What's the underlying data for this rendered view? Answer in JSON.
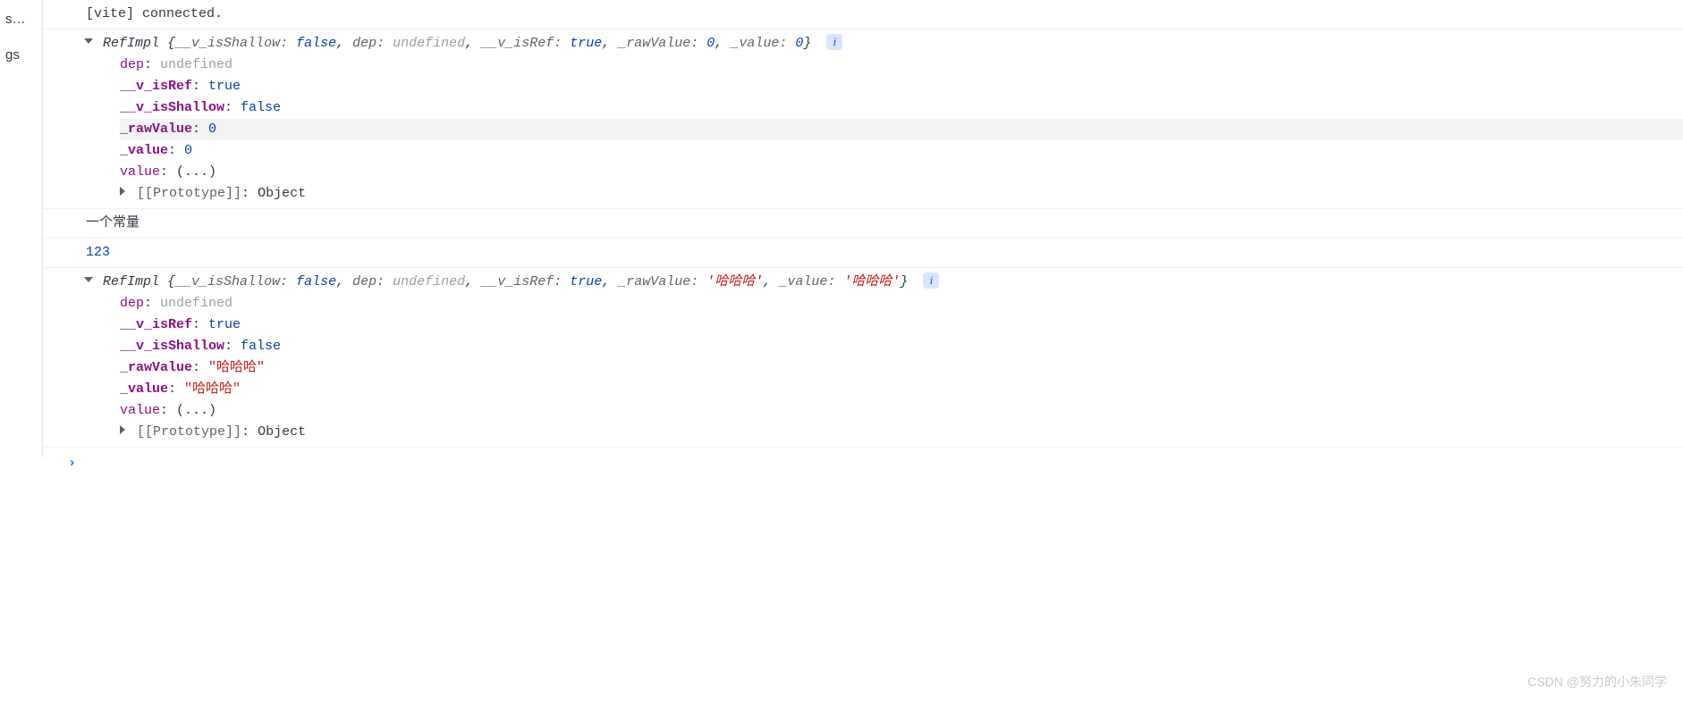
{
  "sidebar": {
    "items": [
      "s…",
      "",
      "gs"
    ]
  },
  "logs": [
    {
      "type": "text",
      "text": "[vite] connected."
    },
    {
      "type": "object",
      "className": "RefImpl",
      "summary": [
        {
          "key": "__v_isShallow",
          "val": "false",
          "vt": "bool"
        },
        {
          "key": "dep",
          "val": "undefined",
          "vt": "undef"
        },
        {
          "key": "__v_isRef",
          "val": "true",
          "vt": "bool"
        },
        {
          "key": "_rawValue",
          "val": "0",
          "vt": "num"
        },
        {
          "key": "_value",
          "val": "0",
          "vt": "num"
        }
      ],
      "props": [
        {
          "key": "dep",
          "val": "undefined",
          "vt": "undef",
          "own": false
        },
        {
          "key": "__v_isRef",
          "val": "true",
          "vt": "bool",
          "own": true
        },
        {
          "key": "__v_isShallow",
          "val": "false",
          "vt": "bool",
          "own": true
        },
        {
          "key": "_rawValue",
          "val": "0",
          "vt": "num",
          "own": true,
          "hover": true
        },
        {
          "key": "_value",
          "val": "0",
          "vt": "num",
          "own": true
        },
        {
          "key": "value",
          "val": "(...)",
          "vt": "ellipsis",
          "own": false
        }
      ],
      "proto": {
        "label": "[[Prototype]]",
        "val": "Object"
      }
    },
    {
      "type": "text",
      "text": "一个常量"
    },
    {
      "type": "number",
      "text": "123"
    },
    {
      "type": "object",
      "className": "RefImpl",
      "summary": [
        {
          "key": "__v_isShallow",
          "val": "false",
          "vt": "bool"
        },
        {
          "key": "dep",
          "val": "undefined",
          "vt": "undef"
        },
        {
          "key": "__v_isRef",
          "val": "true",
          "vt": "bool"
        },
        {
          "key": "_rawValue",
          "val": "'哈哈哈'",
          "vt": "strsq"
        },
        {
          "key": "_value",
          "val": "'哈哈哈'",
          "vt": "strsq"
        }
      ],
      "props": [
        {
          "key": "dep",
          "val": "undefined",
          "vt": "undef",
          "own": false
        },
        {
          "key": "__v_isRef",
          "val": "true",
          "vt": "bool",
          "own": true
        },
        {
          "key": "__v_isShallow",
          "val": "false",
          "vt": "bool",
          "own": true
        },
        {
          "key": "_rawValue",
          "val": "\"哈哈哈\"",
          "vt": "str",
          "own": true
        },
        {
          "key": "_value",
          "val": "\"哈哈哈\"",
          "vt": "str",
          "own": true
        },
        {
          "key": "value",
          "val": "(...)",
          "vt": "ellipsis",
          "own": false
        }
      ],
      "proto": {
        "label": "[[Prototype]]",
        "val": "Object"
      }
    }
  ],
  "prompt": {
    "caret": "›"
  },
  "watermark": "CSDN @努力的小朱同学"
}
